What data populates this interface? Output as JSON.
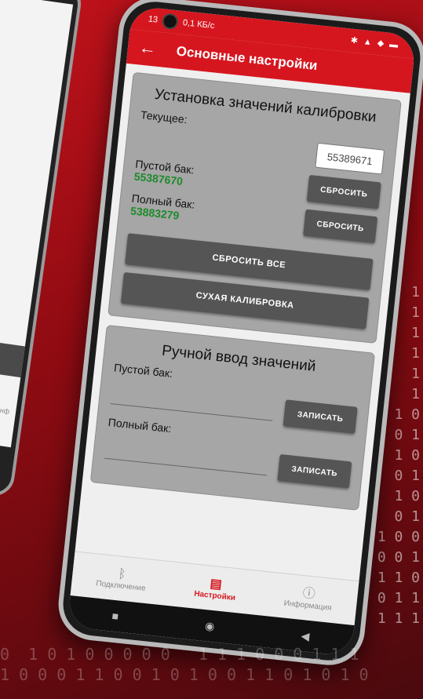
{
  "status": {
    "time": "13",
    "speed": "0,1 КБ/с",
    "icons": "✱ ▲ ◆ ▬"
  },
  "appbar": {
    "back_icon": "←",
    "title": "Основные настройки"
  },
  "calibration": {
    "title": "Установка значений калибровки",
    "current_label": "Текущее:",
    "current_value": "55389671",
    "empty_label": "Пустой бак:",
    "empty_value": "55387670",
    "full_label": "Полный бак:",
    "full_value": "53883279",
    "reset_label": "СБРОСИТЬ",
    "reset_all_label": "СБРОСИТЬ ВСЕ",
    "dry_label": "СУХАЯ КАЛИБРОВКА"
  },
  "manual": {
    "title": "Ручной ввод значений",
    "empty_label": "Пустой бак:",
    "full_label": "Полный бак:",
    "write_label": "ЗАПИСАТЬ"
  },
  "bottomnav": {
    "items": [
      {
        "label": "Подключение",
        "icon": "bluetooth-icon",
        "glyph": "ᛒ"
      },
      {
        "label": "Настройки",
        "icon": "settings-icon",
        "glyph": "▤"
      },
      {
        "label": "Информация",
        "icon": "info-icon",
        "glyph": "ⓘ"
      }
    ]
  },
  "back_phone": {
    "info_text": "Инф"
  },
  "colors": {
    "brand_red": "#d6161f",
    "green_value": "#1d8a2a"
  }
}
